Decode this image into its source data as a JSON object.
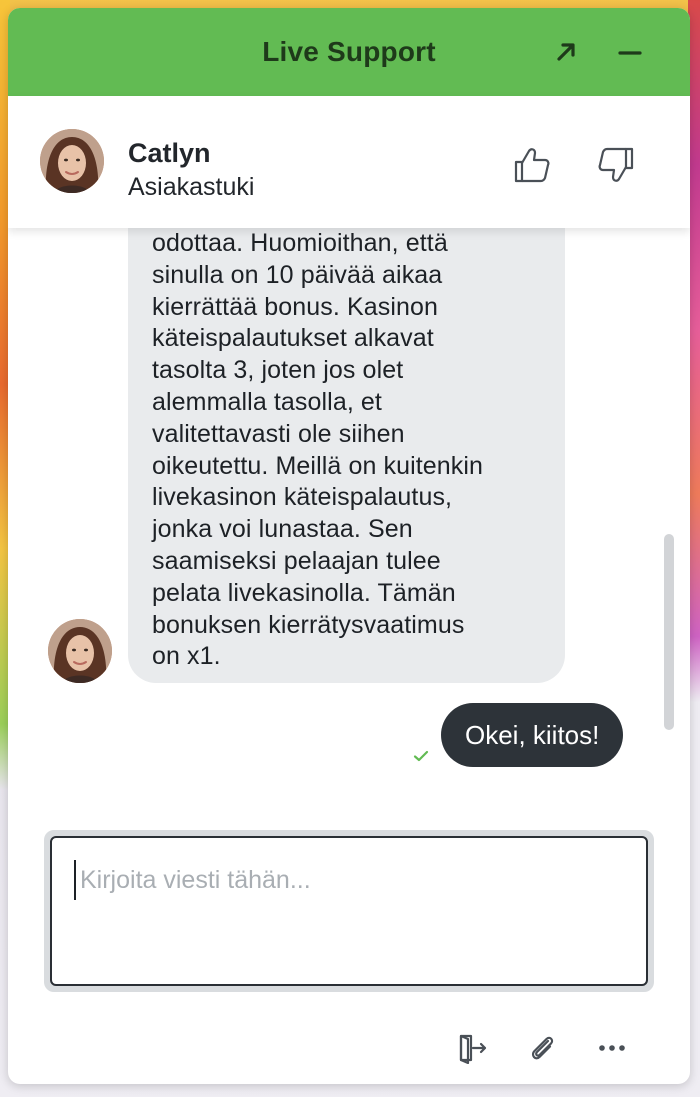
{
  "header": {
    "title": "Live Support",
    "expand_icon": "expand-arrow-icon",
    "minimize_icon": "minimize-icon",
    "accent": "#62bb53"
  },
  "agent": {
    "name": "Catlyn",
    "role": "Asiakastuki",
    "avatar_icon": "agent-avatar",
    "thumbs_up_icon": "thumbs-up-icon",
    "thumbs_down_icon": "thumbs-down-icon"
  },
  "messages": [
    {
      "from": "agent",
      "text": "odottaa. Huomioithan, että\nsinulla on 10 päivää aikaa\nkierrättää bonus. Kasinon\nkäteispalautukset alkavat\ntasolta 3, joten jos olet\nalemmalla tasolla, et\nvalitettavasti ole siihen\noikeutettu. Meillä on kuitenkin\nlivekasinon käteispalautus,\njonka voi lunastaa. Sen\nsaamiseksi pelaajan tulee\npelata livekasinolla. Tämän\nbonuksen kierrätysvaatimus\non x1."
    },
    {
      "from": "user",
      "text": "Okei, kiitos!",
      "status_icon": "check-icon"
    }
  ],
  "composer": {
    "placeholder": "Kirjoita viesti tähän...",
    "value": ""
  },
  "toolbar": {
    "exit_icon": "exit-icon",
    "attach_icon": "paperclip-icon",
    "more_icon": "more-dots-icon"
  }
}
